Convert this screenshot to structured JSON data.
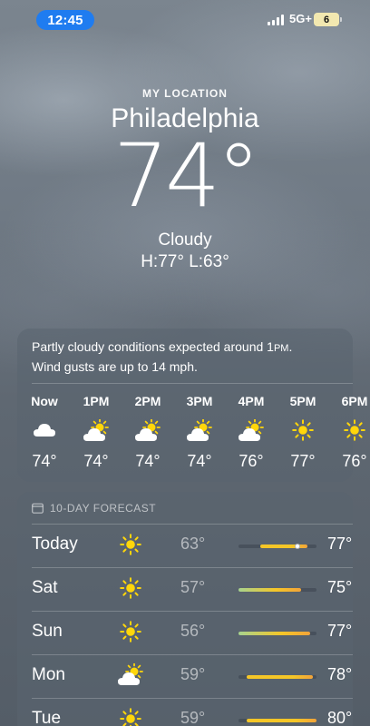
{
  "status_bar": {
    "time": "12:45",
    "network": "5G+",
    "battery": "6"
  },
  "header": {
    "location_label": "MY LOCATION",
    "city": "Philadelphia",
    "temperature": "74°",
    "condition": "Cloudy",
    "high_low": "H:77°  L:63°"
  },
  "hourly": {
    "summary_line1_a": "Partly cloudy conditions expected around 1",
    "summary_line1_pm": "PM",
    "summary_line1_b": ".",
    "summary_line2": "Wind gusts are up to 14 mph.",
    "hours": [
      {
        "label": "Now",
        "icon": "cloud-icon",
        "temp": "74°"
      },
      {
        "label": "1PM",
        "icon": "partly-sunny-icon",
        "temp": "74°"
      },
      {
        "label": "2PM",
        "icon": "partly-sunny-icon",
        "temp": "74°"
      },
      {
        "label": "3PM",
        "icon": "partly-sunny-icon",
        "temp": "74°"
      },
      {
        "label": "4PM",
        "icon": "partly-sunny-icon",
        "temp": "76°"
      },
      {
        "label": "5PM",
        "icon": "sun-icon",
        "temp": "77°"
      },
      {
        "label": "6PM",
        "icon": "sun-icon",
        "temp": "76°"
      }
    ]
  },
  "forecast": {
    "title": "10-DAY FORECAST",
    "days": [
      {
        "day": "Today",
        "icon": "sun-icon",
        "low": "63°",
        "high": "77°",
        "range_start": 0.28,
        "range_end": 0.88,
        "current": 0.75
      },
      {
        "day": "Sat",
        "icon": "sun-icon",
        "low": "57°",
        "high": "75°",
        "range_start": 0.0,
        "range_end": 0.8
      },
      {
        "day": "Sun",
        "icon": "sun-icon",
        "low": "56°",
        "high": "77°",
        "range_start": 0.0,
        "range_end": 0.92
      },
      {
        "day": "Mon",
        "icon": "partly-sunny-icon",
        "low": "59°",
        "high": "78°",
        "range_start": 0.1,
        "range_end": 0.95
      },
      {
        "day": "Tue",
        "icon": "sun-icon",
        "low": "59°",
        "high": "80°",
        "range_start": 0.1,
        "range_end": 1.0
      }
    ]
  },
  "colors": {
    "time_pill": "#1f7cf0",
    "sun": "#ffd60a",
    "bar_yellow": "#f5c627",
    "bar_green": "#a7d38f",
    "bar_orange": "#f2a33a"
  }
}
